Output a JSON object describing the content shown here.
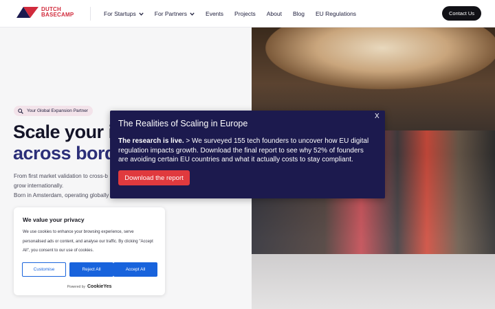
{
  "brand": {
    "line1": "DUTCH",
    "line2": "BASECAMP",
    "color": "#d12b3c"
  },
  "nav": {
    "items": [
      {
        "label": "For Startups",
        "dropdown": true
      },
      {
        "label": "For Partners",
        "dropdown": true
      },
      {
        "label": "Events"
      },
      {
        "label": "Projects"
      },
      {
        "label": "About"
      },
      {
        "label": "Blog"
      },
      {
        "label": "EU Regulations"
      }
    ],
    "contact_label": "Contact Us"
  },
  "hero": {
    "badge": "Your Global Expansion Partner",
    "headline_line1": "Scale your in",
    "headline_line2": "across borde",
    "desc_line1": "From first market validation to cross-b",
    "desc_line2": "grow internationally.",
    "desc_line3": "Born in Amsterdam, operating globally"
  },
  "modal": {
    "title": "The Realities of Scaling in Europe",
    "close": "X",
    "lead": "The research is live.",
    "body": " > We surveyed 155 tech founders to uncover how EU digital regulation impacts growth. Download the final report to see why 52% of founders are avoiding certain EU countries and what it actually costs to stay compliant.",
    "button": "Download the report",
    "bg_color": "#1c1a4e",
    "button_color": "#e03a3e"
  },
  "cookie": {
    "title": "We value your privacy",
    "text": "We use cookies to enhance your browsing experience, serve personalised ads or content, and analyse our traffic. By clicking \"Accept All\", you consent to our use of cookies.",
    "customise": "Customise",
    "reject": "Reject All",
    "accept": "Accept All",
    "powered_by": "Powered by",
    "powered_brand": "CookieYes",
    "accent": "#1863dc"
  }
}
